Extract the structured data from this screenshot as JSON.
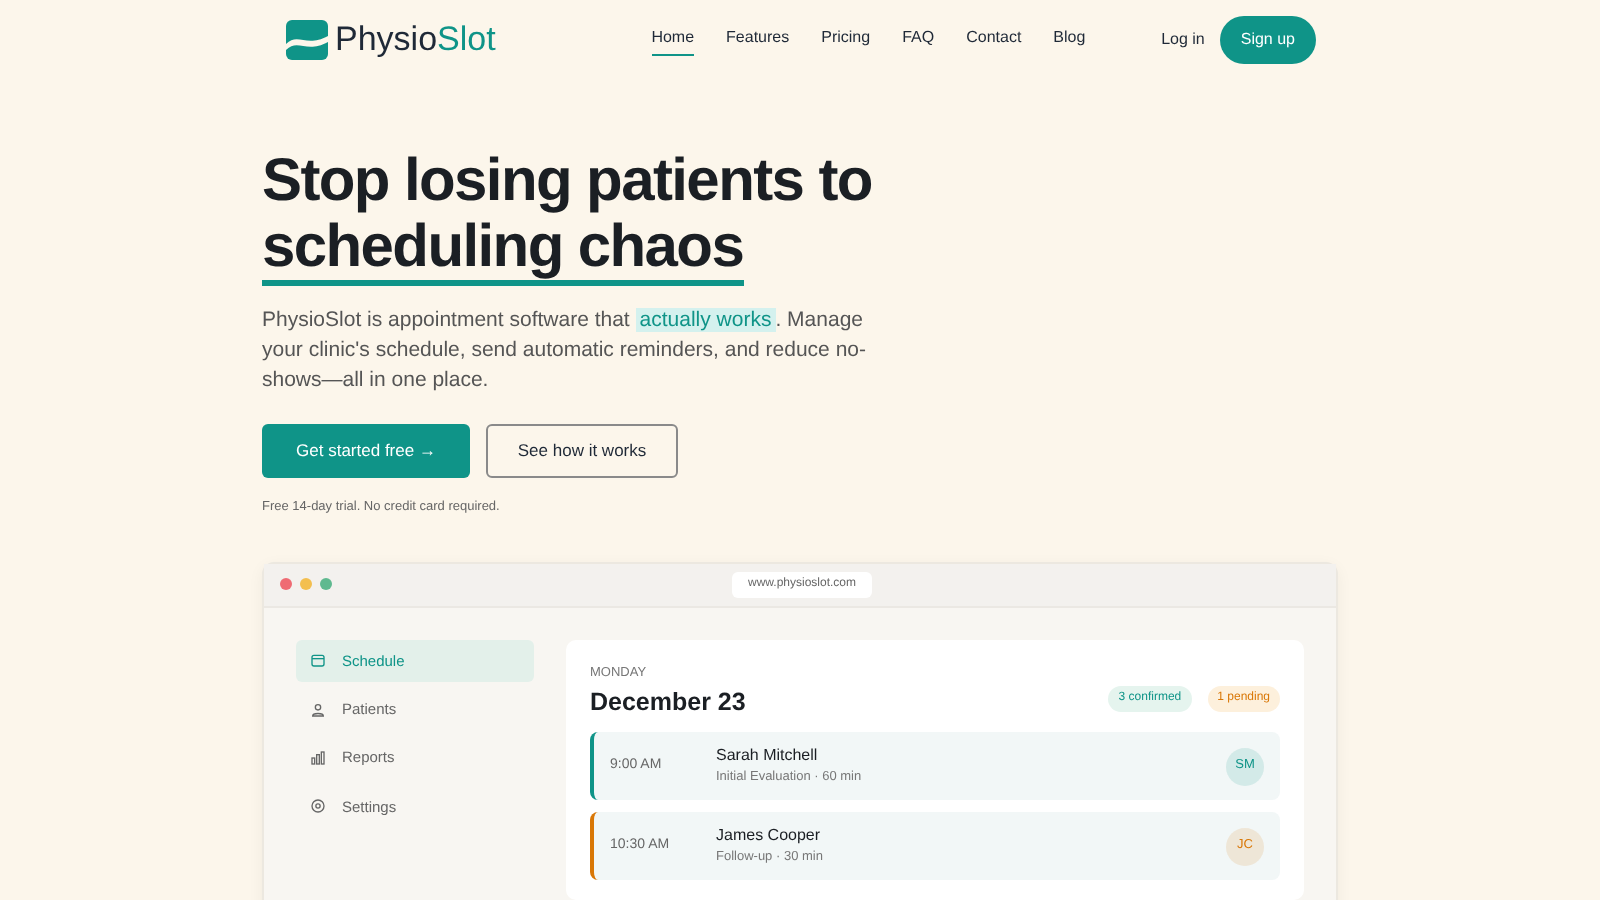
{
  "brand": {
    "first": "Physio",
    "second": "Slot"
  },
  "nav": [
    {
      "label": "Home",
      "selected": true
    },
    {
      "label": "Features",
      "selected": false
    },
    {
      "label": "Pricing",
      "selected": false
    },
    {
      "label": "FAQ",
      "selected": false
    },
    {
      "label": "Contact",
      "selected": false
    },
    {
      "label": "Blog",
      "selected": false
    }
  ],
  "login": "Log in",
  "signup": "Sign up",
  "headline": {
    "line1": "Stop losing patients to",
    "line2": "scheduling chaos"
  },
  "intro": {
    "before": "PhysioSlot is appointment software that",
    "highlight": "actually works",
    "after": ". Manage your clinic's schedule, send automatic reminders, and reduce no-shows—all in one place."
  },
  "primary_button": "Get started free →",
  "secondary_button": "See how it works",
  "note": "Free 14-day trial. No credit card required.",
  "browser": {
    "url": "www.physioslot.com",
    "sidebar": [
      {
        "label": "Schedule",
        "kind": "calendar",
        "selected": true
      },
      {
        "label": "Patients",
        "kind": "person",
        "selected": false
      },
      {
        "label": "Reports",
        "kind": "chart",
        "selected": false
      },
      {
        "label": "Settings",
        "kind": "gear",
        "selected": false
      }
    ],
    "day": "MONDAY",
    "date": "December 23",
    "confirmed": "3 confirmed",
    "pending": "1 pending",
    "appointments": [
      {
        "time": "9:00 AM",
        "name": "Sarah Mitchell",
        "detail": "Initial Evaluation · 60 min",
        "initials": "SM",
        "color": "#0f9488"
      },
      {
        "time": "10:30 AM",
        "name": "James Cooper",
        "detail": "Follow-up · 30 min",
        "initials": "JC",
        "color": "#d97706"
      }
    ]
  }
}
